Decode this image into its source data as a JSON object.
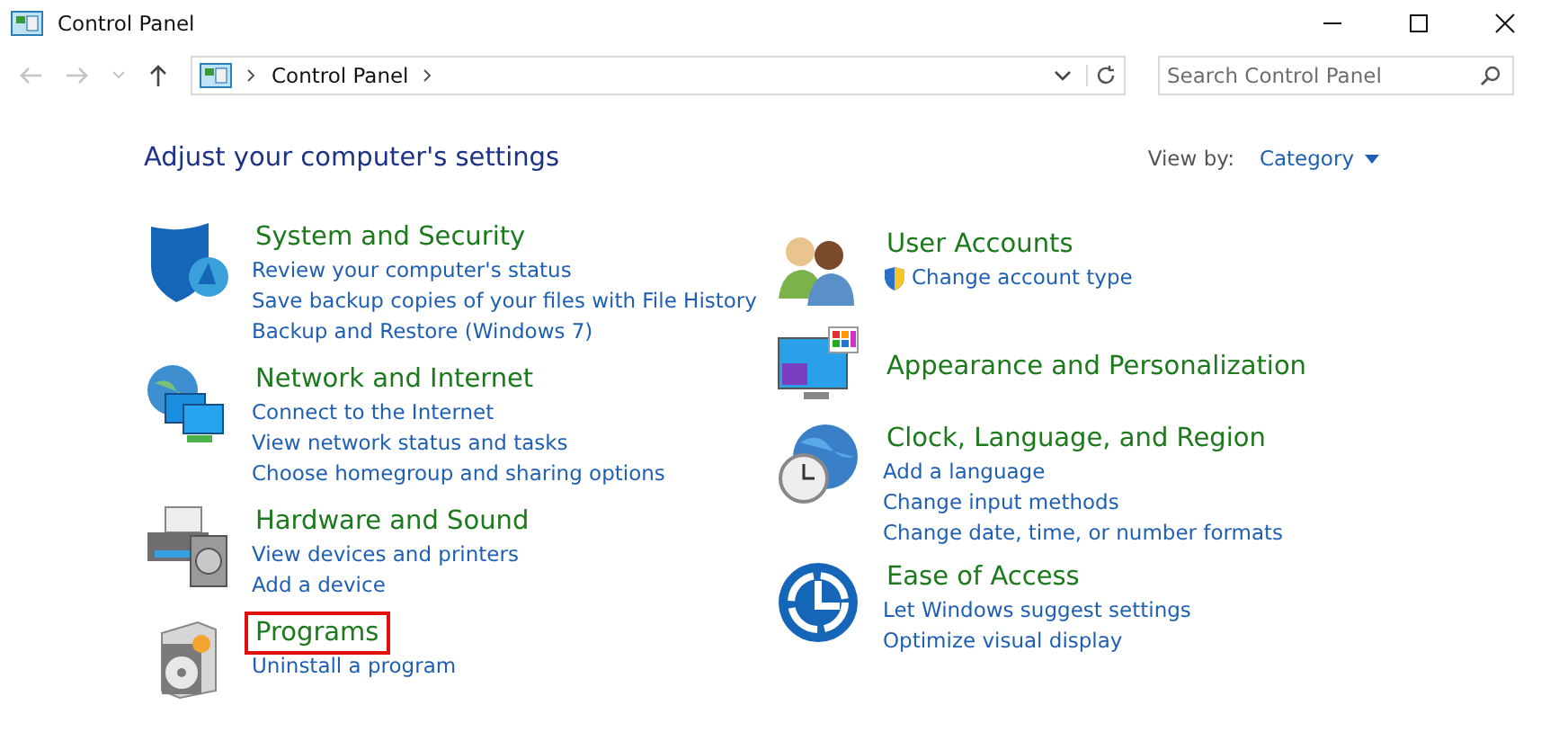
{
  "window": {
    "title": "Control Panel"
  },
  "address": {
    "crumb": "Control Panel"
  },
  "search": {
    "placeholder": "Search Control Panel"
  },
  "heading": "Adjust your computer's settings",
  "view_by": {
    "label": "View by:",
    "value": "Category"
  },
  "columns": [
    [
      {
        "kind": "security",
        "title": "System and Security",
        "highlighted": false,
        "links": [
          {
            "text": "Review your computer's status",
            "shield": false
          },
          {
            "text": "Save backup copies of your files with File History",
            "shield": false
          },
          {
            "text": "Backup and Restore (Windows 7)",
            "shield": false
          }
        ]
      },
      {
        "kind": "network",
        "title": "Network and Internet",
        "highlighted": false,
        "links": [
          {
            "text": "Connect to the Internet",
            "shield": false
          },
          {
            "text": "View network status and tasks",
            "shield": false
          },
          {
            "text": "Choose homegroup and sharing options",
            "shield": false
          }
        ]
      },
      {
        "kind": "hardware",
        "title": "Hardware and Sound",
        "highlighted": false,
        "links": [
          {
            "text": "View devices and printers",
            "shield": false
          },
          {
            "text": "Add a device",
            "shield": false
          }
        ]
      },
      {
        "kind": "programs",
        "title": "Programs",
        "highlighted": true,
        "links": [
          {
            "text": "Uninstall a program",
            "shield": false
          }
        ]
      }
    ],
    [
      {
        "kind": "users",
        "title": "User Accounts",
        "highlighted": false,
        "links": [
          {
            "text": "Change account type",
            "shield": true
          }
        ]
      },
      {
        "kind": "appearance",
        "title": "Appearance and Personalization",
        "highlighted": false
      },
      {
        "kind": "clock",
        "title": "Clock, Language, and Region",
        "highlighted": false,
        "links": [
          {
            "text": "Add a language",
            "shield": false
          },
          {
            "text": "Change input methods",
            "shield": false
          },
          {
            "text": "Change date, time, or number formats",
            "shield": false
          }
        ]
      },
      {
        "kind": "access",
        "title": "Ease of Access",
        "highlighted": false,
        "links": [
          {
            "text": "Let Windows suggest settings",
            "shield": false
          },
          {
            "text": "Optimize visual display",
            "shield": false
          }
        ]
      }
    ]
  ]
}
